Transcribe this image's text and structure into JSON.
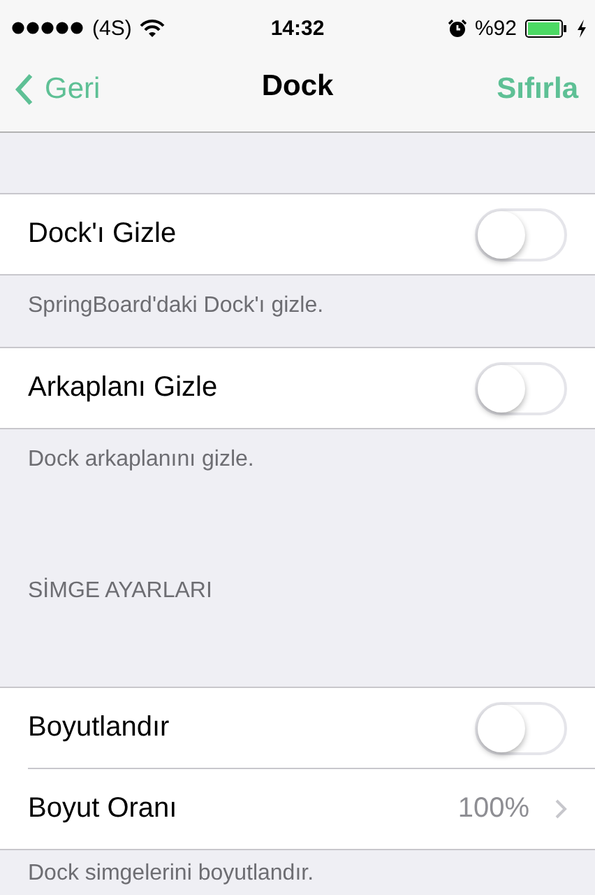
{
  "status_bar": {
    "carrier": "(4S)",
    "time": "14:32",
    "battery": "%92"
  },
  "nav_bar": {
    "back": "Geri",
    "title": "Dock",
    "action": "Sıfırla"
  },
  "sections": [
    {
      "rows": [
        {
          "kind": "toggle",
          "label": "Dock'ı Gizle",
          "on": false
        }
      ],
      "footer": "SpringBoard'daki Dock'ı gizle."
    },
    {
      "rows": [
        {
          "kind": "toggle",
          "label": "Arkaplanı Gizle",
          "on": false
        }
      ],
      "footer": "Dock arkaplanını gizle."
    },
    {
      "header": "SİMGE AYARLARI",
      "rows": [
        {
          "kind": "toggle",
          "label": "Boyutlandır",
          "on": false
        },
        {
          "kind": "value",
          "label": "Boyut Oranı",
          "value": "100%"
        }
      ],
      "footer": "Dock simgelerini boyutlandır."
    }
  ]
}
